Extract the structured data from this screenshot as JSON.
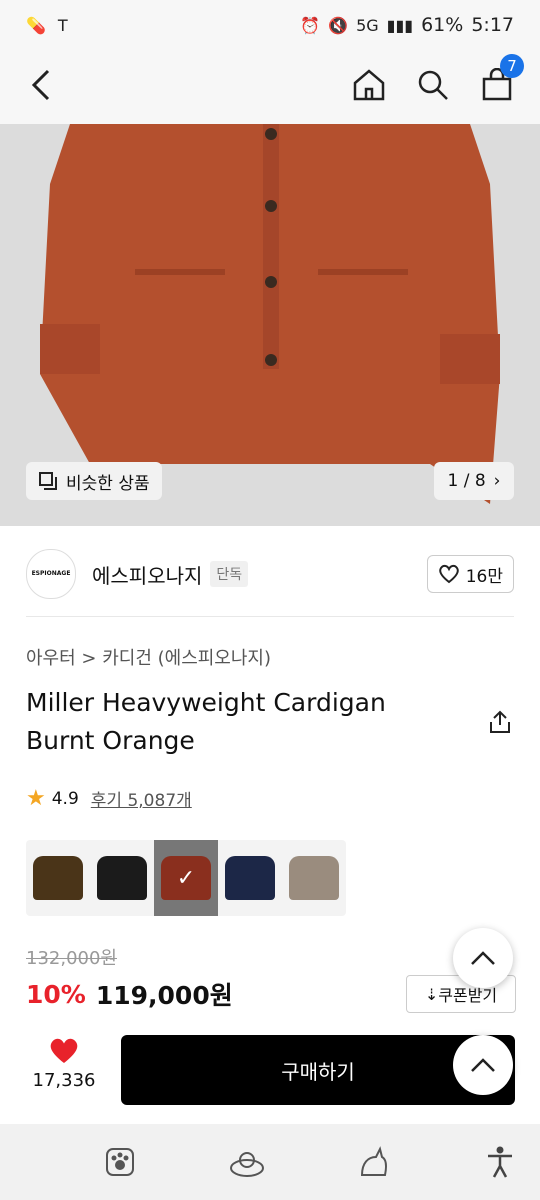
{
  "status": {
    "battery": "61%",
    "time": "5:17",
    "network": "5G"
  },
  "header": {
    "cart_count": "7"
  },
  "hero": {
    "similar_label": "비슷한 상품",
    "pager": "1 / 8"
  },
  "brand": {
    "name": "에스피오나지",
    "tag": "단독",
    "logo_text": "ESPIONAGE",
    "likes": "16만"
  },
  "product": {
    "breadcrumb": "아우터 > 카디건 (에스피오나지)",
    "title": "Miller Heavyweight Cardigan Burnt Orange",
    "rating": "4.9",
    "reviews": "후기 5,087개",
    "original_price": "132,000원",
    "discount": "10%",
    "price": "119,000원",
    "coupon_label": "쿠폰받기"
  },
  "swatches": [
    {
      "color": "#4a3418"
    },
    {
      "color": "#1b1b1b"
    },
    {
      "color": "#8a2f1e"
    },
    {
      "color": "#1c2747"
    },
    {
      "color": "#9a8c7e"
    }
  ],
  "buybar": {
    "heart_count": "17,336",
    "buy_label": "구매하기"
  },
  "colors": {
    "accent_red": "#e8222b",
    "badge_blue": "#1a73e8",
    "sweater": "#b4502e"
  }
}
